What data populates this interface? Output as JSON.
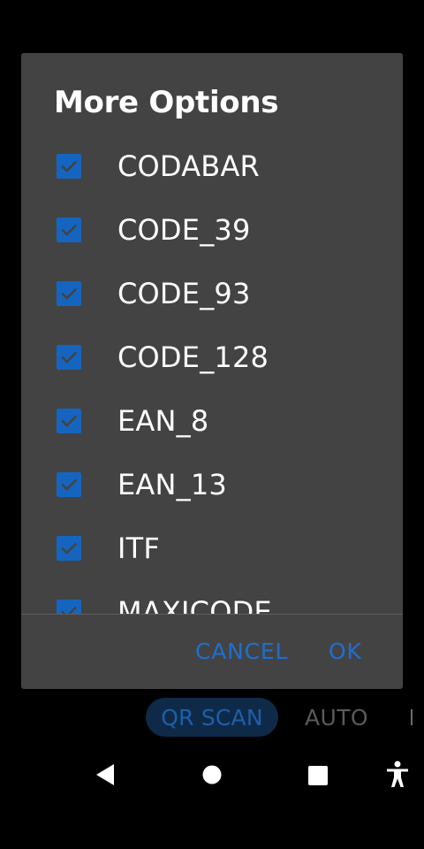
{
  "dialog": {
    "title": "More Options",
    "options": [
      {
        "label": "CODABAR",
        "checked": true
      },
      {
        "label": "CODE_39",
        "checked": true
      },
      {
        "label": "CODE_93",
        "checked": true
      },
      {
        "label": "CODE_128",
        "checked": true
      },
      {
        "label": "EAN_8",
        "checked": true
      },
      {
        "label": "EAN_13",
        "checked": true
      },
      {
        "label": "ITF",
        "checked": true
      },
      {
        "label": "MAXICODE",
        "checked": true
      }
    ],
    "cancel_label": "CANCEL",
    "ok_label": "OK"
  },
  "mode_bar": {
    "selected_label": "QR SCAN",
    "other_label": "AUTO"
  },
  "nav_bar": {
    "icons": [
      "back-icon",
      "home-icon",
      "recents-icon",
      "accessibility-icon"
    ]
  },
  "colors": {
    "accent": "#1e6fd0",
    "checkbox_fill": "#1565c0",
    "dialog_bg": "#434343",
    "screen_bg": "#000000"
  }
}
